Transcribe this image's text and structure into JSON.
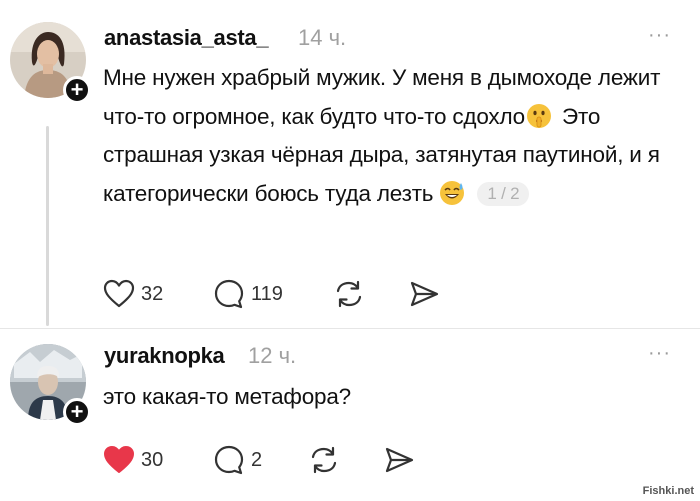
{
  "posts": [
    {
      "username": "anastasia_asta_",
      "time": "14 ч.",
      "more": "···",
      "text_parts": [
        "Мне нужен храбрый мужик. У меня в дымоходе лежит что-то огромное, как будто что-то сдохло",
        " Это страшная узкая чёрная дыра, затянутая паутиной, и я категорически боюсь туда лезть"
      ],
      "emojis": [
        "shushing-face-emoji",
        "sweat-smile-emoji"
      ],
      "page_indicator": "1 / 2",
      "actions": {
        "likes": "32",
        "comments": "119",
        "liked": false
      }
    },
    {
      "username": "yuraknopka",
      "time": "12 ч.",
      "more": "···",
      "text": "это какая-то метафора?",
      "actions": {
        "likes": "30",
        "comments": "2",
        "liked": true
      }
    }
  ],
  "watermark": "Fishki.net",
  "colors": {
    "like_active": "#e8374a",
    "muted_text": "#a0a0a0",
    "icon": "#333333"
  }
}
